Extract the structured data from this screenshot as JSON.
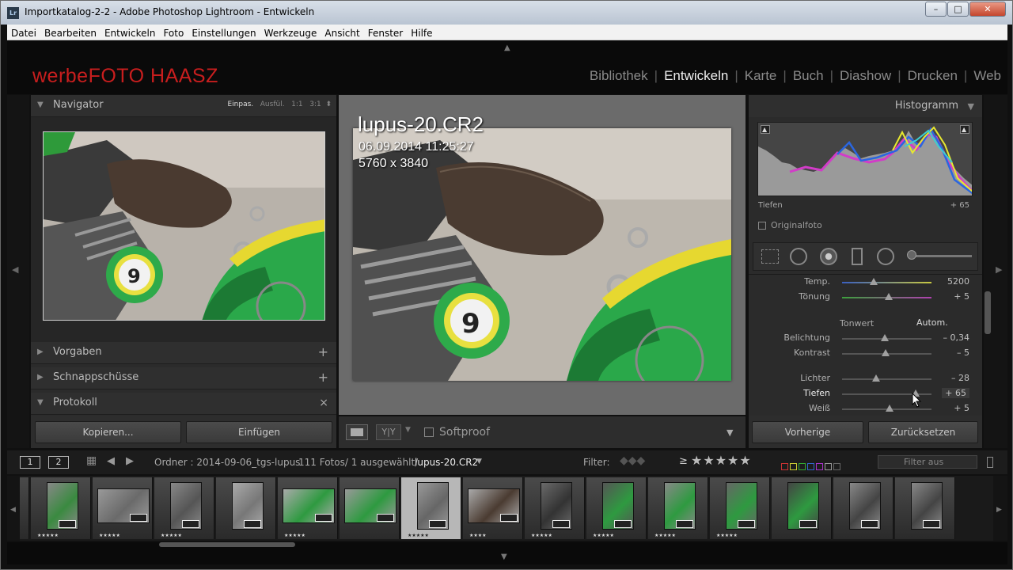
{
  "window": {
    "title": "Importkatalog-2-2 - Adobe Photoshop Lightroom - Entwickeln",
    "app_icon": "Lr"
  },
  "menu": [
    "Datei",
    "Bearbeiten",
    "Entwickeln",
    "Foto",
    "Einstellungen",
    "Werkzeuge",
    "Ansicht",
    "Fenster",
    "Hilfe"
  ],
  "identity_plate": "werbeFOTO HAASZ",
  "modules": [
    "Bibliothek",
    "Entwickeln",
    "Karte",
    "Buch",
    "Diashow",
    "Drucken",
    "Web"
  ],
  "active_module": "Entwickeln",
  "left_panel": {
    "navigator": {
      "title": "Navigator",
      "zoom_options": [
        "Einpas.",
        "Ausfül.",
        "1:1",
        "3:1"
      ],
      "active_zoom": "Einpas."
    },
    "sections": [
      {
        "label": "Vorgaben",
        "action": "+"
      },
      {
        "label": "Schnappschüsse",
        "action": "+"
      },
      {
        "label": "Protokoll",
        "action": "×"
      }
    ],
    "copy_button": "Kopieren...",
    "paste_button": "Einfügen"
  },
  "photo_info": {
    "filename": "lupus-20.CR2",
    "datetime": "06.09.2014 11:25:27",
    "dimensions": "5760 x 3840"
  },
  "center_toolbar": {
    "compare_label": "Y|Y",
    "softproof_label": "Softproof"
  },
  "right_panel": {
    "histogram_title": "Histogramm",
    "hover_label": "Tiefen",
    "hover_value": "+ 65",
    "original_photo_label": "Originalfoto",
    "wb_sliders": [
      {
        "label": "Temp.",
        "value": "5200",
        "pos": 0.35
      },
      {
        "label": "Tönung",
        "value": "+ 5",
        "pos": 0.52
      }
    ],
    "tone_label": "Tonwert",
    "auto_label": "Autom.",
    "tone_sliders": [
      {
        "label": "Belichtung",
        "value": "– 0,34",
        "pos": 0.48
      },
      {
        "label": "Kontrast",
        "value": "– 5",
        "pos": 0.49
      },
      {
        "label": "Lichter",
        "value": "– 28",
        "pos": 0.38
      },
      {
        "label": "Tiefen",
        "value": "+ 65",
        "pos": 0.82
      },
      {
        "label": "Weiß",
        "value": "+ 5",
        "pos": 0.53
      }
    ],
    "previous_button": "Vorherige",
    "reset_button": "Zurücksetzen"
  },
  "filmstrip_bar": {
    "view1": "1",
    "view2": "2",
    "folder_text": "Ordner : 2014-09-06_tgs-lupus",
    "count_text": "111 Fotos/ 1 ausgewählt/",
    "current_file": "lupus-20.CR2",
    "filter_label": "Filter:",
    "rating_operator": "≥",
    "filter_off": "Filter aus"
  },
  "filmstrip": {
    "selected_index": 7,
    "star_ratings": [
      0,
      5,
      5,
      5,
      0,
      5,
      0,
      5,
      4,
      5,
      5,
      5,
      5,
      0,
      0,
      0
    ]
  },
  "colors": {
    "accent_red": "#c81e1e",
    "panel_bg": "#2b2b2b",
    "loupe_bg": "#6b6b6b"
  }
}
